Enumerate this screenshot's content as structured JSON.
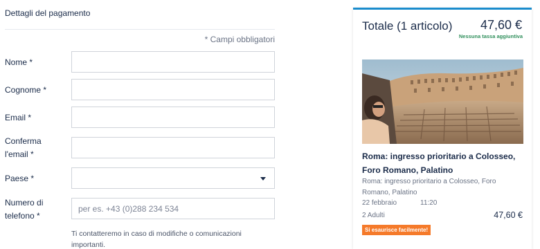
{
  "form": {
    "section_title": "Dettagli del pagamento",
    "required_note": "* Campi obbligatori",
    "fields": {
      "first_name": {
        "label": "Nome *",
        "value": "",
        "placeholder": ""
      },
      "last_name": {
        "label": "Cognome *",
        "value": "",
        "placeholder": ""
      },
      "email": {
        "label": "Email *",
        "value": "",
        "placeholder": ""
      },
      "email_confirm": {
        "label_line1": "Conferma",
        "label_line2": "l'email *",
        "value": "",
        "placeholder": ""
      },
      "country": {
        "label": "Paese *",
        "selected": ""
      },
      "phone": {
        "label_line1": "Numero di",
        "label_line2": "telefono *",
        "value": "",
        "placeholder": "per es. +43 (0)288 234 534"
      }
    },
    "helper_text": "Ti contatteremo in caso di modifiche o comunicazioni importanti."
  },
  "summary": {
    "total_label": "Totale (1 articolo)",
    "total_price": "47,60 €",
    "tax_note": "Nessuna tassa aggiuntiva",
    "tour_title": "Roma: ingresso prioritario a Colosseo, Foro Romano, Palatino",
    "tour_subtitle": "Roma: ingresso prioritario a Colosseo, Foro Romano, Palatino",
    "date": "22 febbraio",
    "time": "11:20",
    "participants": "2 Adulti",
    "item_price": "47,60 €",
    "badge": "Si esaurisce facilmente!"
  },
  "colors": {
    "accent": "#1a8ccc",
    "text": "#1a2b49",
    "tax_green": "#2f8f5b",
    "badge_orange": "#f57a2a"
  }
}
